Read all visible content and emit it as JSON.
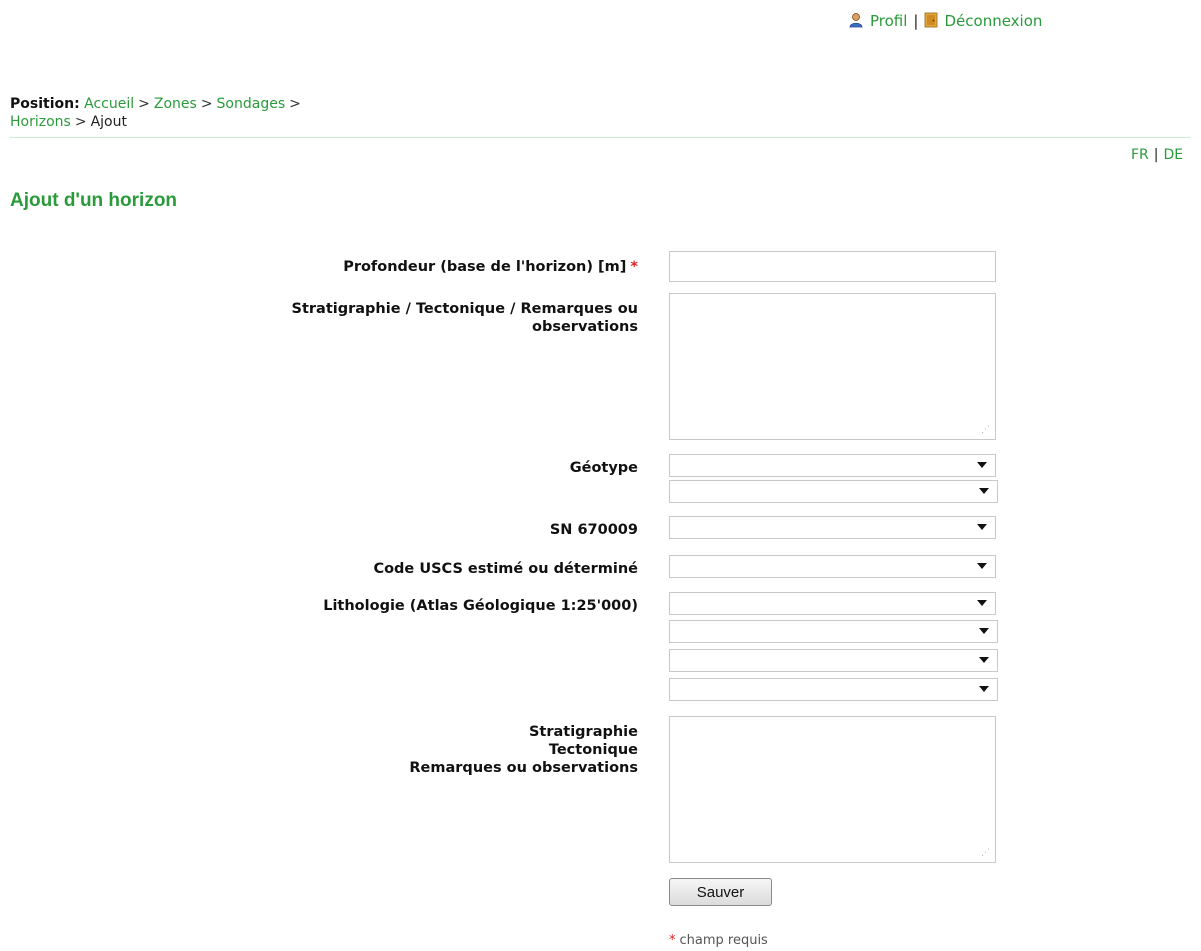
{
  "header": {
    "profile_label": "Profil",
    "separator": "|",
    "logout_label": "Déconnexion"
  },
  "breadcrumb": {
    "prefix": "Position:",
    "items": [
      "Accueil",
      "Zones",
      "Sondages",
      "Horizons",
      "Ajout"
    ],
    "separator": ">"
  },
  "language": {
    "fr": "FR",
    "de": "DE",
    "separator": "|"
  },
  "page_title": "Ajout d'un horizon",
  "form": {
    "depth": {
      "label": "Profondeur (base de l'horizon) [m]",
      "required_mark": "*",
      "value": ""
    },
    "remarks1": {
      "label_line1": "Stratigraphie / Tectonique / Remarques ou",
      "label_line2": "observations",
      "value": ""
    },
    "geotype": {
      "label": "Géotype",
      "value1": "",
      "value2": ""
    },
    "sn": {
      "label": "SN 670009",
      "value": ""
    },
    "uscs": {
      "label": "Code USCS estimé ou déterminé",
      "value": ""
    },
    "lithology": {
      "label": "Lithologie (Atlas Géologique 1:25'000)",
      "values": [
        "",
        "",
        "",
        ""
      ]
    },
    "remarks2": {
      "label_line1": "Stratigraphie",
      "label_line2": "Tectonique",
      "label_line3": "Remarques ou observations",
      "value": ""
    },
    "save_label": "Sauver",
    "required_note": "champ requis",
    "required_mark": "*"
  },
  "icons": {
    "profile": "user-icon",
    "logout": "door-icon"
  },
  "colors": {
    "link": "#2a9a3a",
    "required": "#dd2222"
  }
}
